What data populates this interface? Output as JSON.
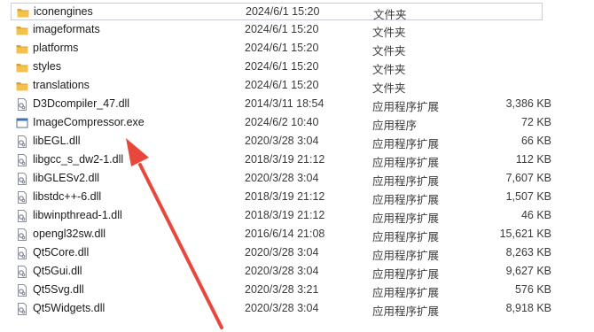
{
  "files": [
    {
      "name": "iconengines",
      "date": "2024/6/1 15:20",
      "type": "文件夹",
      "size": "",
      "icon": "folder-icon"
    },
    {
      "name": "imageformats",
      "date": "2024/6/1 15:20",
      "type": "文件夹",
      "size": "",
      "icon": "folder-icon"
    },
    {
      "name": "platforms",
      "date": "2024/6/1 15:20",
      "type": "文件夹",
      "size": "",
      "icon": "folder-icon"
    },
    {
      "name": "styles",
      "date": "2024/6/1 15:20",
      "type": "文件夹",
      "size": "",
      "icon": "folder-icon"
    },
    {
      "name": "translations",
      "date": "2024/6/1 15:20",
      "type": "文件夹",
      "size": "",
      "icon": "folder-icon"
    },
    {
      "name": "D3Dcompiler_47.dll",
      "date": "2014/3/11 18:54",
      "type": "应用程序扩展",
      "size": "3,386 KB",
      "icon": "dll-icon"
    },
    {
      "name": "ImageCompressor.exe",
      "date": "2024/6/2 10:40",
      "type": "应用程序",
      "size": "72 KB",
      "icon": "exe-icon"
    },
    {
      "name": "libEGL.dll",
      "date": "2020/3/28 3:04",
      "type": "应用程序扩展",
      "size": "66 KB",
      "icon": "dll-icon"
    },
    {
      "name": "libgcc_s_dw2-1.dll",
      "date": "2018/3/19 21:12",
      "type": "应用程序扩展",
      "size": "112 KB",
      "icon": "dll-icon"
    },
    {
      "name": "libGLESv2.dll",
      "date": "2020/3/28 3:04",
      "type": "应用程序扩展",
      "size": "7,607 KB",
      "icon": "dll-icon"
    },
    {
      "name": "libstdc++-6.dll",
      "date": "2018/3/19 21:12",
      "type": "应用程序扩展",
      "size": "1,507 KB",
      "icon": "dll-icon"
    },
    {
      "name": "libwinpthread-1.dll",
      "date": "2018/3/19 21:12",
      "type": "应用程序扩展",
      "size": "46 KB",
      "icon": "dll-icon"
    },
    {
      "name": "opengl32sw.dll",
      "date": "2016/6/14 21:08",
      "type": "应用程序扩展",
      "size": "15,621 KB",
      "icon": "dll-icon"
    },
    {
      "name": "Qt5Core.dll",
      "date": "2020/3/28 3:04",
      "type": "应用程序扩展",
      "size": "8,263 KB",
      "icon": "dll-icon"
    },
    {
      "name": "Qt5Gui.dll",
      "date": "2020/3/28 3:04",
      "type": "应用程序扩展",
      "size": "9,627 KB",
      "icon": "dll-icon"
    },
    {
      "name": "Qt5Svg.dll",
      "date": "2020/3/28 3:21",
      "type": "应用程序扩展",
      "size": "576 KB",
      "icon": "dll-icon"
    },
    {
      "name": "Qt5Widgets.dll",
      "date": "2020/3/28 3:04",
      "type": "应用程序扩展",
      "size": "8,918 KB",
      "icon": "dll-icon"
    }
  ],
  "selected_index": 0,
  "annotation": {
    "icon": "red-arrow-icon",
    "color": "#e8473b"
  },
  "colors": {
    "folder": "#f2c14e",
    "folder_dark": "#d9a32c",
    "selection_border": "#c9ced6"
  }
}
